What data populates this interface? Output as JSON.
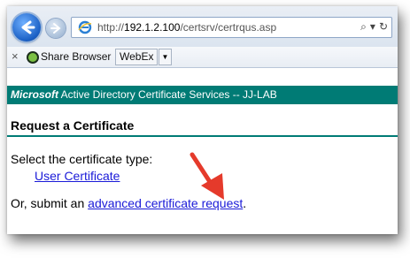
{
  "browser": {
    "url_prefix": "http://",
    "url_host": "192.1.2.100",
    "url_path": "/certsrv/certrqus.asp",
    "search_icon": "search-icon",
    "dropdown_icon": "chevron-down-icon",
    "refresh_icon": "refresh-icon"
  },
  "favorites": {
    "close_glyph": "×",
    "share_label": "Share Browser",
    "webex_label": "WebEx",
    "dropdown_glyph": "▼"
  },
  "banner": {
    "brand": "Microsoft",
    "title": "Active Directory Certificate Services  --  JJ-LAB"
  },
  "page": {
    "heading": "Request a Certificate",
    "prompt": "Select the certificate type:",
    "user_cert_link": "User Certificate",
    "or_text": "Or, submit an ",
    "advanced_link": "advanced certificate request",
    "trailing": "."
  },
  "colors": {
    "banner": "#007b75",
    "link": "#1a1ad8",
    "annotation_arrow": "#e53a2b"
  }
}
